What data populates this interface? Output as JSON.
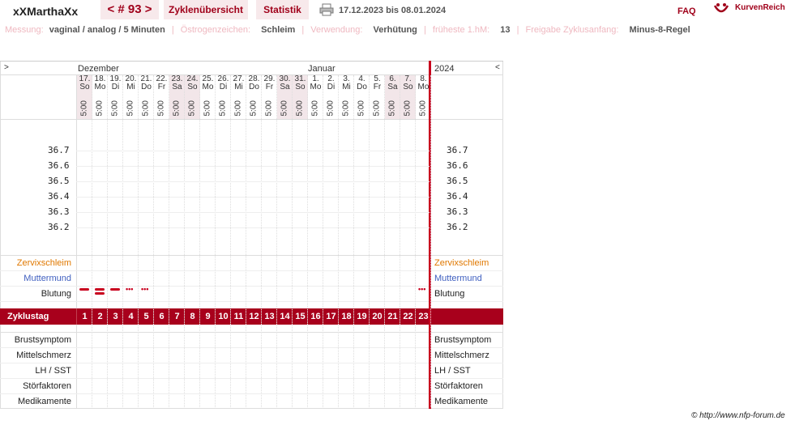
{
  "header": {
    "username": "xXMarthaXx",
    "cycle_nav": "< # 93 >",
    "tab_overview": "Zyklenübersicht",
    "tab_stats": "Statistik",
    "date_range": "17.12.2023 bis 08.01.2024",
    "faq": "FAQ",
    "logo_text": "KurvenReich"
  },
  "info": {
    "messung_label": "Messung:",
    "messung_value": "vaginal / analog / 5 Minuten",
    "oestrogen_label": "Östrogenzeichen:",
    "oestrogen_value": "Schleim",
    "verwendung_label": "Verwendung:",
    "verwendung_value": "Verhütung",
    "hm_label": "früheste 1.hM:",
    "hm_value": "13",
    "freigabe_label": "Freigabe Zyklusanfang:",
    "freigabe_value": "Minus-8-Regel"
  },
  "chart": {
    "toggle_left": ">",
    "toggle_right": "<",
    "month_dec": "Dezember",
    "month_jan": "Januar",
    "year": "2024",
    "days": [
      {
        "d": "17.",
        "w": "So",
        "t": "5:00",
        "we": true
      },
      {
        "d": "18.",
        "w": "Mo",
        "t": "5:00",
        "we": false
      },
      {
        "d": "19.",
        "w": "Di",
        "t": "5:00",
        "we": false
      },
      {
        "d": "20.",
        "w": "Mi",
        "t": "5:00",
        "we": false
      },
      {
        "d": "21.",
        "w": "Do",
        "t": "5:00",
        "we": false
      },
      {
        "d": "22.",
        "w": "Fr",
        "t": "5:00",
        "we": false
      },
      {
        "d": "23.",
        "w": "Sa",
        "t": "5:00",
        "we": true
      },
      {
        "d": "24.",
        "w": "So",
        "t": "5:00",
        "we": true
      },
      {
        "d": "25.",
        "w": "Mo",
        "t": "5:00",
        "we": false
      },
      {
        "d": "26.",
        "w": "Di",
        "t": "5:00",
        "we": false
      },
      {
        "d": "27.",
        "w": "Mi",
        "t": "5:00",
        "we": false
      },
      {
        "d": "28.",
        "w": "Do",
        "t": "5:00",
        "we": false
      },
      {
        "d": "29.",
        "w": "Fr",
        "t": "5:00",
        "we": false
      },
      {
        "d": "30.",
        "w": "Sa",
        "t": "5:00",
        "we": true
      },
      {
        "d": "31.",
        "w": "So",
        "t": "5:00",
        "we": true
      },
      {
        "d": "1.",
        "w": "Mo",
        "t": "5:00",
        "we": false
      },
      {
        "d": "2.",
        "w": "Di",
        "t": "5:00",
        "we": false
      },
      {
        "d": "3.",
        "w": "Mi",
        "t": "5:00",
        "we": false
      },
      {
        "d": "4.",
        "w": "Do",
        "t": "5:00",
        "we": false
      },
      {
        "d": "5.",
        "w": "Fr",
        "t": "5:00",
        "we": false
      },
      {
        "d": "6.",
        "w": "Sa",
        "t": "5:00",
        "we": true
      },
      {
        "d": "7.",
        "w": "So",
        "t": "5:00",
        "we": true
      },
      {
        "d": "8.",
        "w": "Mo",
        "t": "5:00",
        "we": false
      }
    ],
    "temps": [
      "36.7",
      "36.6",
      "36.5",
      "36.4",
      "36.3",
      "36.2"
    ],
    "rows": {
      "zervix": "Zervixschleim",
      "muttermund": "Muttermund",
      "blutung": "Blutung",
      "zyklustag": "Zyklustag",
      "brust": "Brustsymptom",
      "mittel": "Mittelschmerz",
      "lh": "LH / SST",
      "stoer": "Störfaktoren",
      "medi": "Medikamente"
    },
    "cycle_days": [
      "1",
      "2",
      "3",
      "4",
      "5",
      "6",
      "7",
      "8",
      "9",
      "10",
      "11",
      "12",
      "13",
      "14",
      "15",
      "16",
      "17",
      "18",
      "19",
      "20",
      "21",
      "22",
      "23"
    ],
    "bleeding": [
      "heavy",
      "heavy",
      "medium",
      "spotting",
      "spotting",
      "",
      "",
      "",
      "",
      "",
      "",
      "",
      "",
      "",
      "",
      "",
      "",
      "",
      "",
      "",
      "",
      "",
      "spotting"
    ],
    "colors": {
      "accent": "#a8001c",
      "zervix": "#e07800",
      "muttermund": "#4060c0",
      "redline": "#c8001e"
    }
  },
  "footer": {
    "copyright": "© http://www.nfp-forum.de"
  }
}
